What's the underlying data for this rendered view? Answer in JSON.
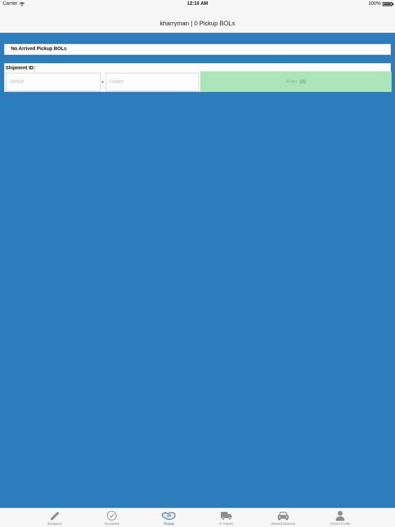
{
  "status_bar": {
    "carrier": "Carrier",
    "time": "12:10 AM",
    "battery": "100%"
  },
  "nav": {
    "title": "kharryman | 0 Pickup BOLs"
  },
  "arrived": {
    "message": "No Arrived Pickup BOLs"
  },
  "shipment": {
    "label": "Shipment ID:",
    "store_placeholder": "Store#",
    "separator": "-",
    "code_placeholder": "Code#",
    "enter_label": "Enter"
  },
  "tabs": [
    {
      "label": "Assigned",
      "icon": "pencil-icon"
    },
    {
      "label": "Accepted",
      "icon": "check-circle-icon"
    },
    {
      "label": "Pickup",
      "icon": "handshake-icon"
    },
    {
      "label": "In Transit",
      "icon": "truck-icon"
    },
    {
      "label": "Arrived Delivery",
      "icon": "car-icon"
    },
    {
      "label": "Driver Profile",
      "icon": "person-icon"
    }
  ],
  "colors": {
    "background": "#2b7dbc",
    "enter_button": "#abe5b8",
    "active_tab": "#2b7dbc",
    "inactive_tab": "#8e8e8e"
  }
}
